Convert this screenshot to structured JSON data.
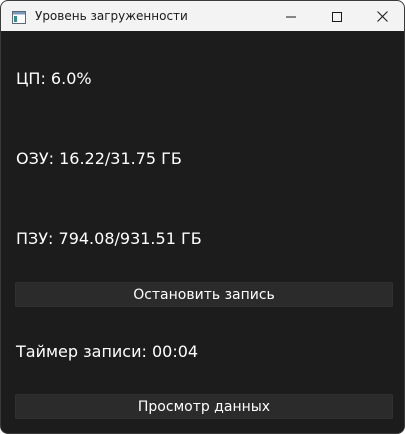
{
  "window": {
    "title": "Уровень загруженности",
    "icon": "app-window-icon"
  },
  "controls": {
    "minimize_icon": "minimize-icon",
    "maximize_icon": "maximize-icon",
    "close_icon": "close-icon"
  },
  "stats": {
    "cpu": "ЦП: 6.0%",
    "ram": "ОЗУ: 16.22/31.75 ГБ",
    "rom": "ПЗУ: 794.08/931.51 ГБ",
    "timer": "Таймер записи: 00:04"
  },
  "buttons": {
    "stop_recording": "Остановить запись",
    "view_data": "Просмотр данных"
  },
  "colors": {
    "background": "#1c1c1c",
    "titlebar": "#f3f3f3",
    "button": "#2b2b2b",
    "text": "#ffffff"
  }
}
